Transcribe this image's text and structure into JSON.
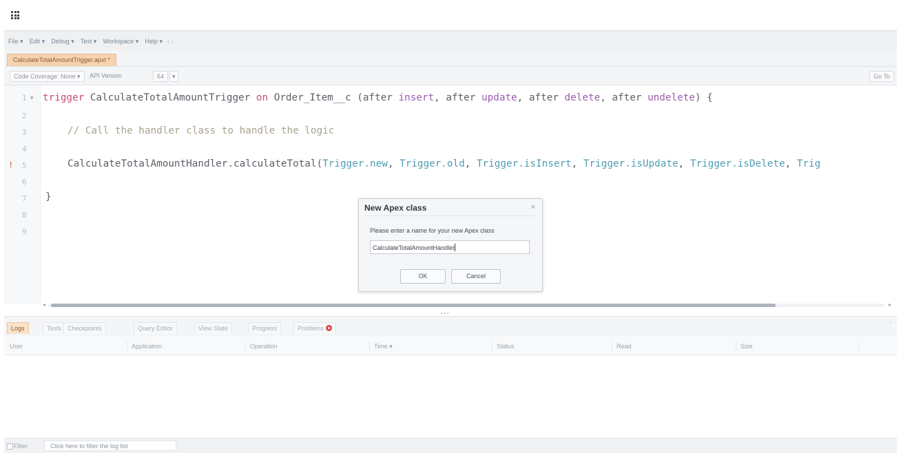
{
  "app": {
    "launcher_icon": "app-launcher-grid-icon"
  },
  "menu": {
    "items": [
      "File ▾",
      "Edit ▾",
      "Debug ▾",
      "Test ▾",
      "Workspace ▾",
      "Help ▾"
    ],
    "nav_icons": "‹ ›"
  },
  "file_tab": {
    "label": "CalculateTotalAmountTrigger.apxt *"
  },
  "toolbar": {
    "code_coverage": "Code Coverage: None ▾",
    "api_version_label": "API Version",
    "api_version_value": "64",
    "api_version_arrow": "▾",
    "goto": "Go To"
  },
  "editor": {
    "line_numbers": [
      "1",
      "2",
      "3",
      "4",
      "5",
      "6",
      "7",
      "8",
      "9"
    ],
    "fold_marker": "▾",
    "error_marker": "!",
    "lines": {
      "l1_trigger": "trigger",
      "l1_name": " CalculateTotalAmountTrigger ",
      "l1_on": "on",
      "l1_obj": " Order_Item__c (after ",
      "l1_insert": "insert",
      "l1_sep1": ", after ",
      "l1_update": "update",
      "l1_sep2": ", after ",
      "l1_delete": "delete",
      "l1_sep3": ", after ",
      "l1_undelete": "undelete",
      "l1_end": ") {",
      "l3_comment": "// Call the handler class to handle the logic",
      "l5_call": "CalculateTotalAmountHandler.calculateTotal(",
      "l5_t1": "Trigger.new",
      "l5_s1": ", ",
      "l5_t2": "Trigger.old",
      "l5_s2": ", ",
      "l5_t3": "Trigger.isInsert",
      "l5_s3": ", ",
      "l5_t4": "Trigger.isUpdate",
      "l5_s4": ", ",
      "l5_t5": "Trigger.isDelete",
      "l5_s5": ", ",
      "l5_t6": "Trig",
      "l7_close": "}"
    }
  },
  "scroll": {
    "left_arrow": "◂",
    "right_arrow": "▸"
  },
  "splitter": "▪▪▪",
  "panel_tabs": {
    "logs": "Logs",
    "tests": "Tests",
    "checkpoints": "Checkpoints",
    "query_editor": "Query Editor",
    "view_state": "View State",
    "progress": "Progress",
    "problems": "Problems",
    "expand": "▫"
  },
  "log_columns": [
    "User",
    "Application",
    "Operation",
    "Time ▾",
    "Status",
    "Read",
    "Size"
  ],
  "filter": {
    "label": "Filter",
    "placeholder": "Click here to filter the log list"
  },
  "dialog": {
    "title": "New Apex class",
    "close": "×",
    "prompt": "Please enter a name for your new Apex class",
    "input_value": "CalculateTotalAmountHandler",
    "ok": "OK",
    "cancel": "Cancel"
  }
}
